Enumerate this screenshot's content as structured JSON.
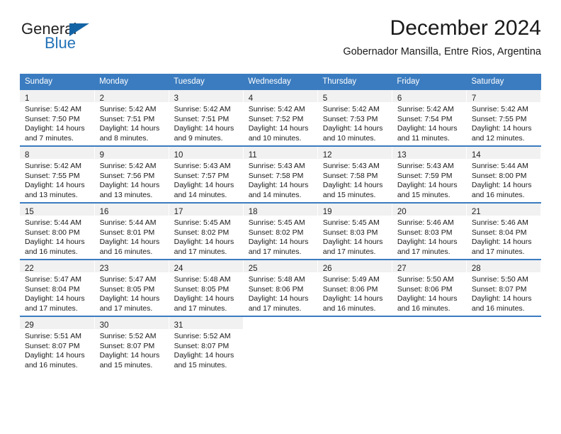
{
  "brand": {
    "name_part1": "General",
    "name_part2": "Blue",
    "logo_icon": "triangle-flag-icon"
  },
  "header": {
    "month_title": "December 2024",
    "location": "Gobernador Mansilla, Entre Rios, Argentina"
  },
  "colors": {
    "header_blue": "#3b7cc0",
    "brand_blue": "#2272b8",
    "daynum_band": "#f1f1f1",
    "text": "#1a1a1a"
  },
  "weekday_headers": [
    "Sunday",
    "Monday",
    "Tuesday",
    "Wednesday",
    "Thursday",
    "Friday",
    "Saturday"
  ],
  "weeks": [
    [
      {
        "day": "1",
        "sunrise": "Sunrise: 5:42 AM",
        "sunset": "Sunset: 7:50 PM",
        "daylight1": "Daylight: 14 hours",
        "daylight2": "and 7 minutes."
      },
      {
        "day": "2",
        "sunrise": "Sunrise: 5:42 AM",
        "sunset": "Sunset: 7:51 PM",
        "daylight1": "Daylight: 14 hours",
        "daylight2": "and 8 minutes."
      },
      {
        "day": "3",
        "sunrise": "Sunrise: 5:42 AM",
        "sunset": "Sunset: 7:51 PM",
        "daylight1": "Daylight: 14 hours",
        "daylight2": "and 9 minutes."
      },
      {
        "day": "4",
        "sunrise": "Sunrise: 5:42 AM",
        "sunset": "Sunset: 7:52 PM",
        "daylight1": "Daylight: 14 hours",
        "daylight2": "and 10 minutes."
      },
      {
        "day": "5",
        "sunrise": "Sunrise: 5:42 AM",
        "sunset": "Sunset: 7:53 PM",
        "daylight1": "Daylight: 14 hours",
        "daylight2": "and 10 minutes."
      },
      {
        "day": "6",
        "sunrise": "Sunrise: 5:42 AM",
        "sunset": "Sunset: 7:54 PM",
        "daylight1": "Daylight: 14 hours",
        "daylight2": "and 11 minutes."
      },
      {
        "day": "7",
        "sunrise": "Sunrise: 5:42 AM",
        "sunset": "Sunset: 7:55 PM",
        "daylight1": "Daylight: 14 hours",
        "daylight2": "and 12 minutes."
      }
    ],
    [
      {
        "day": "8",
        "sunrise": "Sunrise: 5:42 AM",
        "sunset": "Sunset: 7:55 PM",
        "daylight1": "Daylight: 14 hours",
        "daylight2": "and 13 minutes."
      },
      {
        "day": "9",
        "sunrise": "Sunrise: 5:42 AM",
        "sunset": "Sunset: 7:56 PM",
        "daylight1": "Daylight: 14 hours",
        "daylight2": "and 13 minutes."
      },
      {
        "day": "10",
        "sunrise": "Sunrise: 5:43 AM",
        "sunset": "Sunset: 7:57 PM",
        "daylight1": "Daylight: 14 hours",
        "daylight2": "and 14 minutes."
      },
      {
        "day": "11",
        "sunrise": "Sunrise: 5:43 AM",
        "sunset": "Sunset: 7:58 PM",
        "daylight1": "Daylight: 14 hours",
        "daylight2": "and 14 minutes."
      },
      {
        "day": "12",
        "sunrise": "Sunrise: 5:43 AM",
        "sunset": "Sunset: 7:58 PM",
        "daylight1": "Daylight: 14 hours",
        "daylight2": "and 15 minutes."
      },
      {
        "day": "13",
        "sunrise": "Sunrise: 5:43 AM",
        "sunset": "Sunset: 7:59 PM",
        "daylight1": "Daylight: 14 hours",
        "daylight2": "and 15 minutes."
      },
      {
        "day": "14",
        "sunrise": "Sunrise: 5:44 AM",
        "sunset": "Sunset: 8:00 PM",
        "daylight1": "Daylight: 14 hours",
        "daylight2": "and 16 minutes."
      }
    ],
    [
      {
        "day": "15",
        "sunrise": "Sunrise: 5:44 AM",
        "sunset": "Sunset: 8:00 PM",
        "daylight1": "Daylight: 14 hours",
        "daylight2": "and 16 minutes."
      },
      {
        "day": "16",
        "sunrise": "Sunrise: 5:44 AM",
        "sunset": "Sunset: 8:01 PM",
        "daylight1": "Daylight: 14 hours",
        "daylight2": "and 16 minutes."
      },
      {
        "day": "17",
        "sunrise": "Sunrise: 5:45 AM",
        "sunset": "Sunset: 8:02 PM",
        "daylight1": "Daylight: 14 hours",
        "daylight2": "and 17 minutes."
      },
      {
        "day": "18",
        "sunrise": "Sunrise: 5:45 AM",
        "sunset": "Sunset: 8:02 PM",
        "daylight1": "Daylight: 14 hours",
        "daylight2": "and 17 minutes."
      },
      {
        "day": "19",
        "sunrise": "Sunrise: 5:45 AM",
        "sunset": "Sunset: 8:03 PM",
        "daylight1": "Daylight: 14 hours",
        "daylight2": "and 17 minutes."
      },
      {
        "day": "20",
        "sunrise": "Sunrise: 5:46 AM",
        "sunset": "Sunset: 8:03 PM",
        "daylight1": "Daylight: 14 hours",
        "daylight2": "and 17 minutes."
      },
      {
        "day": "21",
        "sunrise": "Sunrise: 5:46 AM",
        "sunset": "Sunset: 8:04 PM",
        "daylight1": "Daylight: 14 hours",
        "daylight2": "and 17 minutes."
      }
    ],
    [
      {
        "day": "22",
        "sunrise": "Sunrise: 5:47 AM",
        "sunset": "Sunset: 8:04 PM",
        "daylight1": "Daylight: 14 hours",
        "daylight2": "and 17 minutes."
      },
      {
        "day": "23",
        "sunrise": "Sunrise: 5:47 AM",
        "sunset": "Sunset: 8:05 PM",
        "daylight1": "Daylight: 14 hours",
        "daylight2": "and 17 minutes."
      },
      {
        "day": "24",
        "sunrise": "Sunrise: 5:48 AM",
        "sunset": "Sunset: 8:05 PM",
        "daylight1": "Daylight: 14 hours",
        "daylight2": "and 17 minutes."
      },
      {
        "day": "25",
        "sunrise": "Sunrise: 5:48 AM",
        "sunset": "Sunset: 8:06 PM",
        "daylight1": "Daylight: 14 hours",
        "daylight2": "and 17 minutes."
      },
      {
        "day": "26",
        "sunrise": "Sunrise: 5:49 AM",
        "sunset": "Sunset: 8:06 PM",
        "daylight1": "Daylight: 14 hours",
        "daylight2": "and 16 minutes."
      },
      {
        "day": "27",
        "sunrise": "Sunrise: 5:50 AM",
        "sunset": "Sunset: 8:06 PM",
        "daylight1": "Daylight: 14 hours",
        "daylight2": "and 16 minutes."
      },
      {
        "day": "28",
        "sunrise": "Sunrise: 5:50 AM",
        "sunset": "Sunset: 8:07 PM",
        "daylight1": "Daylight: 14 hours",
        "daylight2": "and 16 minutes."
      }
    ],
    [
      {
        "day": "29",
        "sunrise": "Sunrise: 5:51 AM",
        "sunset": "Sunset: 8:07 PM",
        "daylight1": "Daylight: 14 hours",
        "daylight2": "and 16 minutes."
      },
      {
        "day": "30",
        "sunrise": "Sunrise: 5:52 AM",
        "sunset": "Sunset: 8:07 PM",
        "daylight1": "Daylight: 14 hours",
        "daylight2": "and 15 minutes."
      },
      {
        "day": "31",
        "sunrise": "Sunrise: 5:52 AM",
        "sunset": "Sunset: 8:07 PM",
        "daylight1": "Daylight: 14 hours",
        "daylight2": "and 15 minutes."
      },
      {
        "day": "",
        "sunrise": "",
        "sunset": "",
        "daylight1": "",
        "daylight2": ""
      },
      {
        "day": "",
        "sunrise": "",
        "sunset": "",
        "daylight1": "",
        "daylight2": ""
      },
      {
        "day": "",
        "sunrise": "",
        "sunset": "",
        "daylight1": "",
        "daylight2": ""
      },
      {
        "day": "",
        "sunrise": "",
        "sunset": "",
        "daylight1": "",
        "daylight2": ""
      }
    ]
  ]
}
